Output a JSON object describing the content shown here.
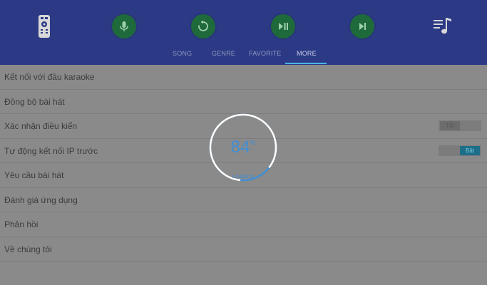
{
  "toolbar": {
    "icons": [
      "remote-icon",
      "microphone-icon",
      "replay-icon",
      "play-pause-icon",
      "skip-next-icon",
      "playlist-icon"
    ]
  },
  "tabs": [
    {
      "label": "SONG"
    },
    {
      "label": "GENRE"
    },
    {
      "label": "FAVORITE"
    },
    {
      "label": "MORE",
      "active": true
    }
  ],
  "settings": [
    {
      "label": "Kết nối với đầu karaoke"
    },
    {
      "label": "Đồng bộ bài hát"
    },
    {
      "label": "Xác nhận điều kiển",
      "toggle": "Tắt"
    },
    {
      "label": "Tự động kết nối IP trước",
      "toggle": "Bật"
    },
    {
      "label": "Yêu cầu bài hát"
    },
    {
      "label": "Đánh giá ứng dụng"
    },
    {
      "label": "Phản hồi"
    },
    {
      "label": "Về chúng tôi"
    }
  ],
  "loading": {
    "value": "84",
    "unit": "%",
    "label": "Loading",
    "progress": 0.84
  },
  "colors": {
    "header": "#2c3a86",
    "accent": "#4bb3e6",
    "button": "#1f6a3a",
    "overlay": "#8a8a8a",
    "loader": "#3e8fd6"
  }
}
